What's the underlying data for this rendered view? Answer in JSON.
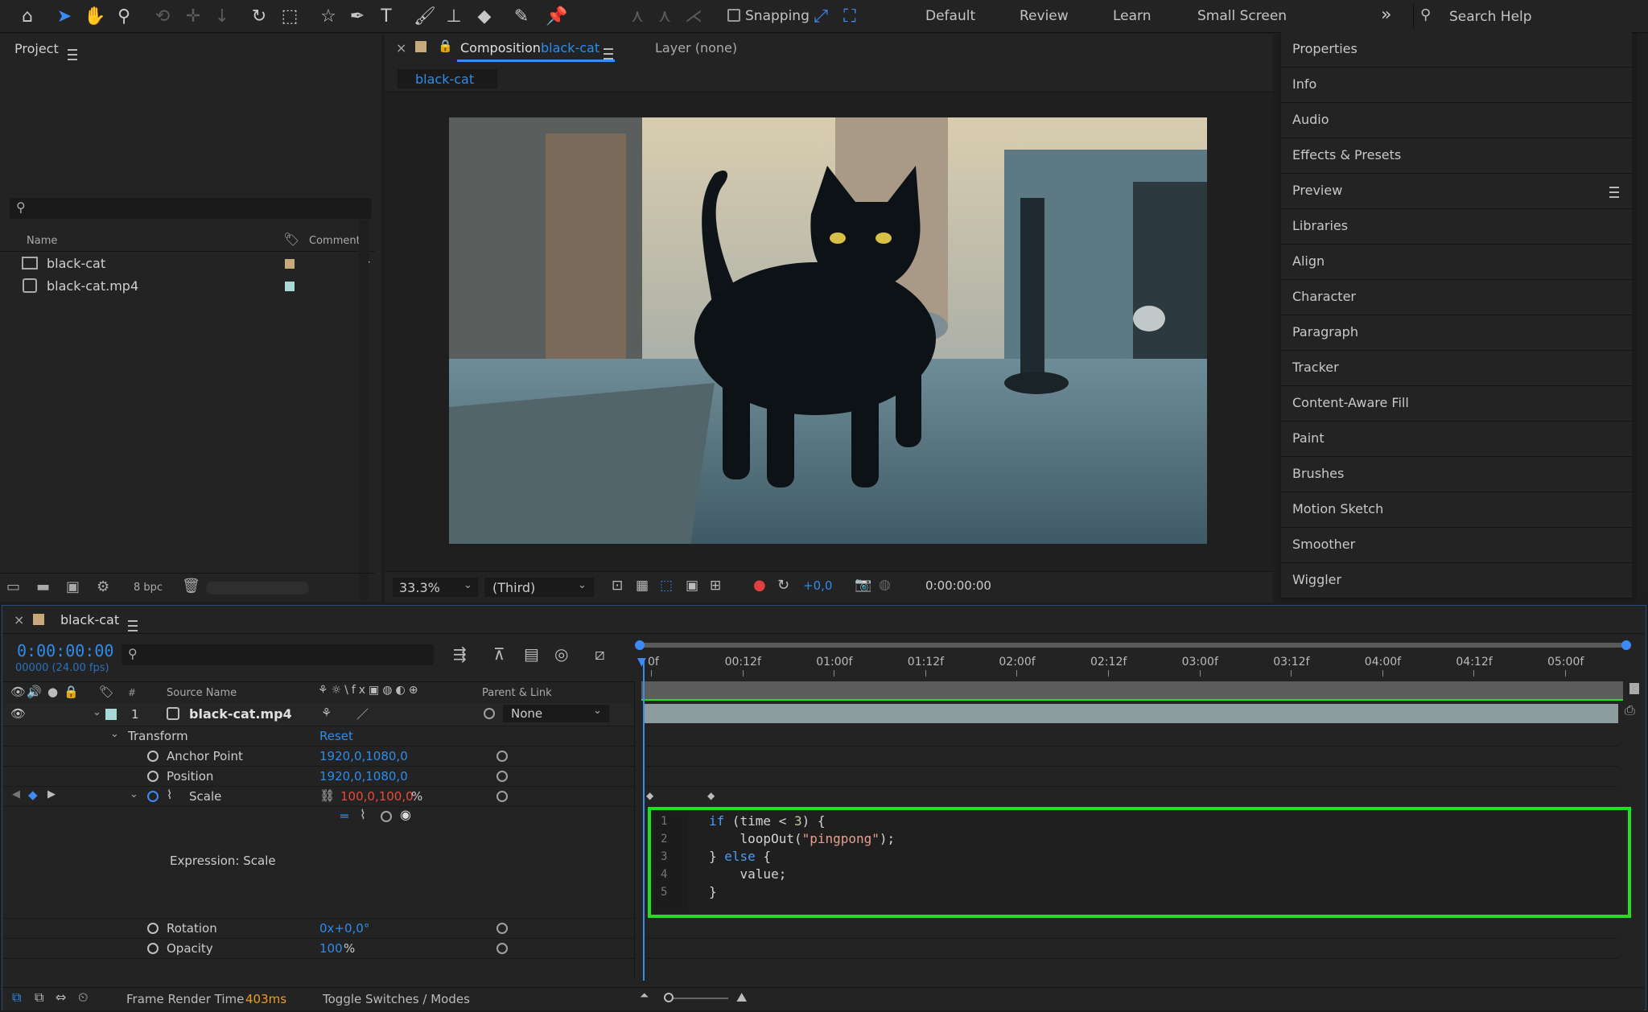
{
  "toolbar": {
    "snapping_label": "Snapping",
    "workspaces": [
      "Default",
      "Review",
      "Learn",
      "Small Screen"
    ],
    "search_placeholder": "Search Help"
  },
  "project": {
    "title": "Project",
    "columns": {
      "name": "Name",
      "comment": "Comment"
    },
    "items": [
      {
        "name": "black-cat",
        "label_color": "#c8a97a",
        "icon": "composition-icon"
      },
      {
        "name": "black-cat.mp4",
        "label_color": "#a8d8d8",
        "icon": "footage-icon"
      }
    ],
    "bpc": "8 bpc"
  },
  "composition": {
    "tab_label": "Composition",
    "tab_name": "black-cat",
    "layer_tab": "Layer (none)",
    "breadcrumb": "black-cat",
    "zoom": "33.3%",
    "resolution": "(Third)",
    "exposure": "+0,0",
    "timecode": "0:00:00:00"
  },
  "right_panels": [
    "Properties",
    "Info",
    "Audio",
    "Effects & Presets",
    "Preview",
    "Libraries",
    "Align",
    "Character",
    "Paragraph",
    "Tracker",
    "Content-Aware Fill",
    "Paint",
    "Brushes",
    "Motion Sketch",
    "Smoother",
    "Wiggler"
  ],
  "timeline": {
    "tab_name": "black-cat",
    "current_time": "0:00:00:00",
    "frame_info": "00000 (24.00 fps)",
    "columns": {
      "num": "#",
      "source": "Source Name",
      "parent": "Parent & Link"
    },
    "layer": {
      "num": "1",
      "name": "black-cat.mp4",
      "parent": "None"
    },
    "transform": {
      "label": "Transform",
      "reset": "Reset"
    },
    "properties": {
      "anchor": {
        "label": "Anchor Point",
        "value": "1920,0,1080,0"
      },
      "position": {
        "label": "Position",
        "value": "1920,0,1080,0"
      },
      "scale": {
        "label": "Scale",
        "value": "100,0,100,0",
        "unit": "%"
      },
      "rotation": {
        "label": "Rotation",
        "value": "0x+0,0°"
      },
      "opacity": {
        "label": "Opacity",
        "value": "100",
        "unit": "%"
      }
    },
    "expression_label": "Expression: Scale",
    "ruler": [
      "0f",
      "00:12f",
      "01:00f",
      "01:12f",
      "02:00f",
      "02:12f",
      "03:00f",
      "03:12f",
      "04:00f",
      "04:12f",
      "05:00f"
    ],
    "code_lines": [
      {
        "n": "1",
        "text": "if (time < 3) {"
      },
      {
        "n": "2",
        "text": "    loopOut(\"pingpong\");"
      },
      {
        "n": "3",
        "text": "} else {"
      },
      {
        "n": "4",
        "text": "    value;"
      },
      {
        "n": "5",
        "text": "}"
      }
    ],
    "footer": {
      "frame_render_label": "Frame Render Time",
      "frame_render_value": "403ms",
      "toggle_label": "Toggle Switches / Modes"
    }
  }
}
